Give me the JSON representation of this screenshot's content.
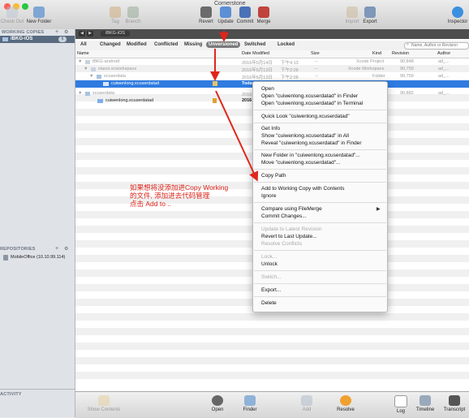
{
  "window": {
    "title": "Cornerstone"
  },
  "toolbar": {
    "check_out": "Check Out",
    "new_folder": "New Folder",
    "tag": "Tag",
    "branch": "Branch",
    "revert": "Revert",
    "update": "Update",
    "commit": "Commit",
    "merge": "Merge",
    "import": "Import",
    "export": "Export",
    "inspector": "Inspector"
  },
  "sidebar": {
    "working_copies_head": "WORKING COPIES",
    "working_copy_item": "iBKG-iOS",
    "working_copy_badge": "6",
    "repositories_head": "REPOSITORIES",
    "repository_item": "MobileOffice (10.10.99.114)",
    "activity_head": "ACTIVITY"
  },
  "main": {
    "path_label": "iBKG-iOS",
    "search_placeholder": "Name, Author or Revision",
    "filters": [
      "All",
      "Changed",
      "Modified",
      "Conflicted",
      "Missing",
      "Unversioned",
      "Switched",
      "Locked"
    ],
    "columns": {
      "name": "Name",
      "date": "Date Modified",
      "size": "Size",
      "kind": "Kind",
      "revision": "Revision",
      "author": "Author"
    },
    "rows": [
      {
        "name": "iBKG-android",
        "date": "2016年5月14日",
        "time": "下午4:13",
        "size": "--",
        "kind": "Xcode Project",
        "revision": "90,848",
        "author": "ad_...",
        "style": "dim"
      },
      {
        "name": "xiaoxi.xcworkspace",
        "date": "2016年5月13日",
        "time": "下午2:09",
        "size": "--",
        "kind": "Xcode Workspace",
        "revision": "90,759",
        "author": "ad_...",
        "style": "dim"
      },
      {
        "name": "xcuserdata",
        "date": "2016年5月13日",
        "time": "下午2:09",
        "size": "--",
        "kind": "Folder",
        "revision": "90,759",
        "author": "ad_...",
        "style": "dim"
      },
      {
        "name": "cuiwenlong.xcuserdatad",
        "date": "Today",
        "time": "",
        "size": "",
        "kind": "",
        "revision": "",
        "author": "",
        "style": "sel"
      },
      {
        "name": "xcuserdata",
        "date": "2016年5月13日",
        "time": "",
        "size": "",
        "kind": "",
        "revision": "90,882",
        "author": "ad_...",
        "style": "dim"
      },
      {
        "name": "cuiwenlong.xcuserdatad",
        "date": "2016",
        "time": "",
        "size": "",
        "kind": "",
        "revision": "",
        "author": "",
        "style": "dark"
      }
    ]
  },
  "context_menu": {
    "items": [
      {
        "label": "Open",
        "enabled": true
      },
      {
        "label": "Open \"cuiwenlong.xcuserdatad\" in Finder",
        "enabled": true
      },
      {
        "label": "Open \"cuiwenlong.xcuserdatad\" in Terminal",
        "enabled": true
      },
      {
        "label": "Quick Look \"cuiwenlong.xcuserdatad\"",
        "enabled": true
      },
      {
        "label": "Get Info",
        "enabled": true
      },
      {
        "label": "Show \"cuiwenlong.xcuserdatad\" in All",
        "enabled": true
      },
      {
        "label": "Reveal \"cuiwenlong.xcuserdatad\" in Finder",
        "enabled": true
      },
      {
        "label": "New Folder in \"cuiwenlong.xcuserdatad\"...",
        "enabled": true
      },
      {
        "label": "Move \"cuiwenlong.xcuserdatad\"...",
        "enabled": true
      },
      {
        "label": "Copy Path",
        "enabled": true
      },
      {
        "label": "Add to Working Copy with Contents",
        "enabled": true
      },
      {
        "label": "Ignore",
        "enabled": true
      },
      {
        "label": "Compare using FileMerge",
        "enabled": true
      },
      {
        "label": "Commit Changes...",
        "enabled": true
      },
      {
        "label": "Update to Latest Revision",
        "enabled": false
      },
      {
        "label": "Revert to Last Update...",
        "enabled": true
      },
      {
        "label": "Resolve Conflicts",
        "enabled": false
      },
      {
        "label": "Lock...",
        "enabled": false
      },
      {
        "label": "Unlock",
        "enabled": true
      },
      {
        "label": "Switch...",
        "enabled": false
      },
      {
        "label": "Export...",
        "enabled": true
      },
      {
        "label": "Delete",
        "enabled": true
      }
    ]
  },
  "annotation": {
    "line1": "如果想将没添加进Copy Working",
    "line2": "的文件, 添加进去代码管理",
    "line3": "点击 Add to .."
  },
  "bottom": {
    "show_contents": "Show Contents",
    "open": "Open",
    "finder": "Finder",
    "add": "Add",
    "resolve": "Resolve",
    "log": "Log",
    "timeline": "Timeline",
    "transcript": "Transcript"
  },
  "colors": {
    "selection": "#2f7be0",
    "annotation": "#e0261b",
    "darkbar": "#4e4e4e"
  }
}
